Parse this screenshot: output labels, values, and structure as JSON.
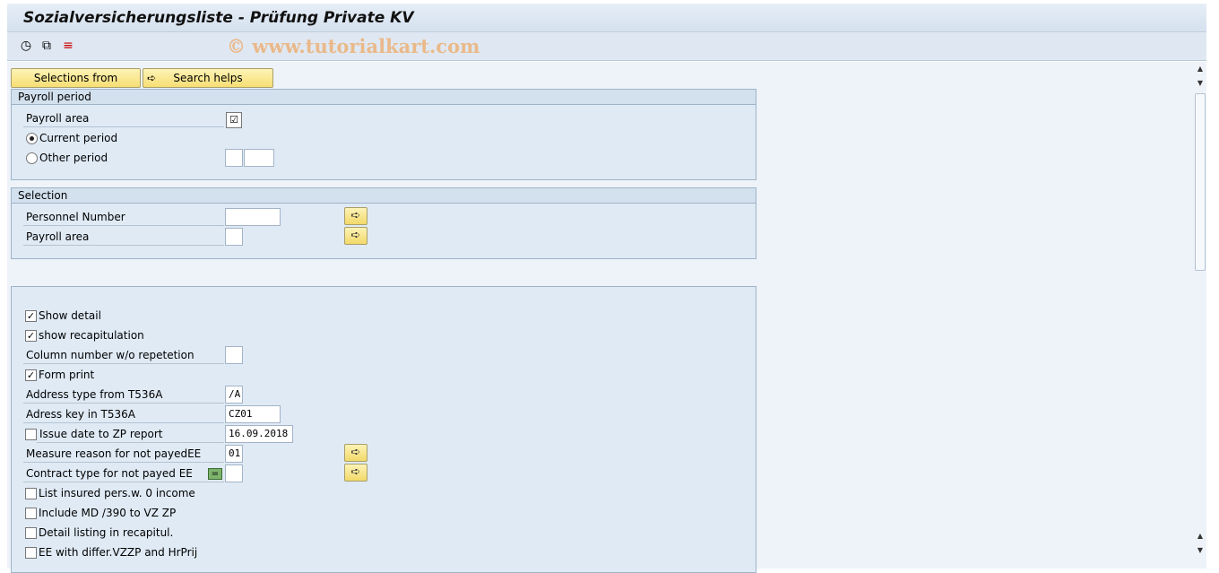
{
  "window": {
    "title": "Sozialversicherungsliste - Prüfung Private KV",
    "watermark": "© www.tutorialkart.com"
  },
  "toolbar": {
    "icons": [
      "execute-icon",
      "copy-variant-icon",
      "selection-options-icon"
    ]
  },
  "buttons": {
    "selections_from": "Selections from",
    "search_helps": "Search helps"
  },
  "payroll_period": {
    "title": "Payroll period",
    "payroll_area": "Payroll area",
    "payroll_area_checked": true,
    "current_period": "Current period",
    "other_period": "Other period",
    "selected": "current"
  },
  "selection": {
    "title": "Selection",
    "personnel_number": "Personnel Number",
    "payroll_area": "Payroll area"
  },
  "options": {
    "show_detail": "Show detail",
    "show_recap": "show recapitulation",
    "column_number": "Column number w/o repetetion",
    "form_print": "Form print",
    "address_type": "Address type from T536A",
    "address_type_value": "/A",
    "address_key": "Adress key in T536A",
    "address_key_value": "CZ01",
    "issue_date": "Issue date to ZP report",
    "issue_date_value": "16.09.2018",
    "measure_reason": "Measure reason for not payedEE",
    "measure_reason_value": "01",
    "contract_type": "Contract type for not payed EE",
    "list_insured": "List insured pers.w. 0 income",
    "include_md": "Include MD /390 to VZ ZP",
    "detail_listing": "Detail listing in recapitul.",
    "ee_differ": "EE with differ.VZZP and HrPrij"
  }
}
